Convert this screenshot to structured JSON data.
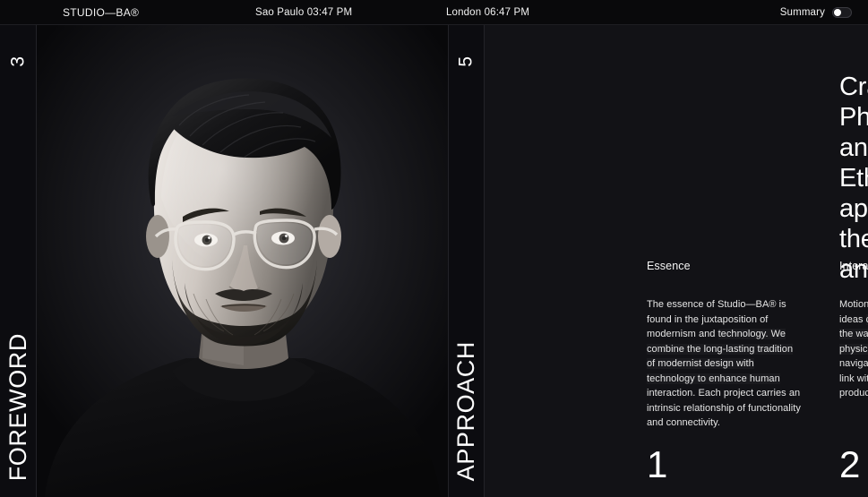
{
  "topbar": {
    "logo": "STUDIO—BA®",
    "clock_one": "Sao Paulo 03:47 PM",
    "clock_two": "London 06:47 PM",
    "summary_label": "Summary",
    "toggle_state": "off"
  },
  "rails": [
    {
      "number": "3",
      "title": "FOREWORD"
    },
    {
      "number": "5",
      "title": "APPROACH"
    }
  ],
  "portrait": {
    "alt": "Black and white portrait of a bearded man wearing clear-framed glasses and a black turtleneck"
  },
  "content": {
    "headline_lines": [
      "Crafting Digital",
      "Physical Spaces",
      "and a Design",
      "Ethos that",
      "approaches",
      "the practical",
      "and poetic."
    ],
    "columns": [
      {
        "number": "1",
        "heading": "Essence",
        "body_lead": "The essence of Studio—BA® is found in the juxtaposition of modernism and ",
        "body_band": "technology. We combine the long-lasting tradition of modernist design with technology to enhance human ",
        "body_tail": "interaction. Each project carries an intrinsic relationship of functionality and connectivity."
      },
      {
        "number": "2",
        "heading": "Interaction",
        "body_lead": "Motion and interaction are how ideas ",
        "body_band": "can feel alive. We design for the way people move through physical and digital space, ",
        "body_tail": "navigating gesture and rhythm to link with the people who use our products."
      }
    ]
  },
  "colors": {
    "page_background": "#0b0b0e",
    "topbar_background": "#09090b",
    "rail_background": "#0c0c10",
    "content_background": "#121216",
    "divider": "#232328",
    "text_primary": "#ffffff",
    "text_secondary": "#e6e6e6"
  }
}
